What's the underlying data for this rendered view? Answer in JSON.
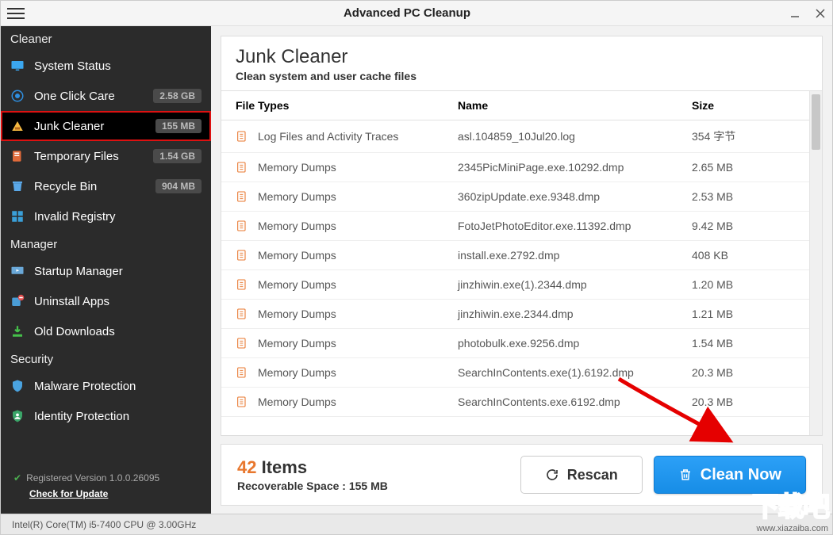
{
  "titlebar": {
    "title": "Advanced PC Cleanup"
  },
  "sidebar": {
    "sections": [
      {
        "title": "Cleaner",
        "items": [
          {
            "id": "system-status",
            "label": "System Status",
            "badge": "",
            "icon": "monitor",
            "iconColor": "#3ba7f0"
          },
          {
            "id": "one-click-care",
            "label": "One Click Care",
            "badge": "2.58 GB",
            "icon": "target",
            "iconColor": "#2f8fe0"
          },
          {
            "id": "junk-cleaner",
            "label": "Junk Cleaner",
            "badge": "155 MB",
            "icon": "junk",
            "iconColor": "#f5b942",
            "active": true
          },
          {
            "id": "temporary-files",
            "label": "Temporary Files",
            "badge": "1.54 GB",
            "icon": "temp",
            "iconColor": "#e06a3a"
          },
          {
            "id": "recycle-bin",
            "label": "Recycle Bin",
            "badge": "904 MB",
            "icon": "bin",
            "iconColor": "#5aa8e8"
          },
          {
            "id": "invalid-registry",
            "label": "Invalid Registry",
            "badge": "",
            "icon": "registry",
            "iconColor": "#3a9fd8"
          }
        ]
      },
      {
        "title": "Manager",
        "items": [
          {
            "id": "startup-manager",
            "label": "Startup Manager",
            "badge": "",
            "icon": "startup",
            "iconColor": "#6aa8d8"
          },
          {
            "id": "uninstall-apps",
            "label": "Uninstall Apps",
            "badge": "",
            "icon": "uninstall",
            "iconColor": "#4a9dd6"
          },
          {
            "id": "old-downloads",
            "label": "Old Downloads",
            "badge": "",
            "icon": "download",
            "iconColor": "#45c04a"
          }
        ]
      },
      {
        "title": "Security",
        "items": [
          {
            "id": "malware-protection",
            "label": "Malware Protection",
            "badge": "",
            "icon": "shield",
            "iconColor": "#4aa3e0"
          },
          {
            "id": "identity-protection",
            "label": "Identity Protection",
            "badge": "",
            "icon": "identity",
            "iconColor": "#3aa568"
          }
        ]
      }
    ],
    "footer": {
      "registered": "Registered Version 1.0.0.26095",
      "update_link": "Check for Update"
    }
  },
  "page": {
    "title": "Junk Cleaner",
    "subtitle": "Clean system and user cache files"
  },
  "table": {
    "headers": {
      "type": "File Types",
      "name": "Name",
      "size": "Size"
    },
    "rows": [
      {
        "type": "Log Files and Activity Traces",
        "name": "asl.104859_10Jul20.log",
        "size": "354 字节"
      },
      {
        "type": "Memory Dumps",
        "name": "2345PicMiniPage.exe.10292.dmp",
        "size": "2.65 MB"
      },
      {
        "type": "Memory Dumps",
        "name": "360zipUpdate.exe.9348.dmp",
        "size": "2.53 MB"
      },
      {
        "type": "Memory Dumps",
        "name": "FotoJetPhotoEditor.exe.11392.dmp",
        "size": "9.42 MB"
      },
      {
        "type": "Memory Dumps",
        "name": "install.exe.2792.dmp",
        "size": "408 KB"
      },
      {
        "type": "Memory Dumps",
        "name": "jinzhiwin.exe(1).2344.dmp",
        "size": "1.20 MB"
      },
      {
        "type": "Memory Dumps",
        "name": "jinzhiwin.exe.2344.dmp",
        "size": "1.21 MB"
      },
      {
        "type": "Memory Dumps",
        "name": "photobulk.exe.9256.dmp",
        "size": "1.54 MB"
      },
      {
        "type": "Memory Dumps",
        "name": "SearchInContents.exe(1).6192.dmp",
        "size": "20.3 MB"
      },
      {
        "type": "Memory Dumps",
        "name": "SearchInContents.exe.6192.dmp",
        "size": "20.3 MB"
      }
    ]
  },
  "footer": {
    "count": "42",
    "count_label": "Items",
    "recoverable_label": "Recoverable Space : 155 MB",
    "rescan": "Rescan",
    "clean": "Clean Now"
  },
  "statusbar": {
    "text": "Intel(R) Core(TM) i5-7400 CPU @ 3.00GHz"
  },
  "watermark": {
    "big": "下载吧",
    "url": "www.xiazaiba.com"
  }
}
